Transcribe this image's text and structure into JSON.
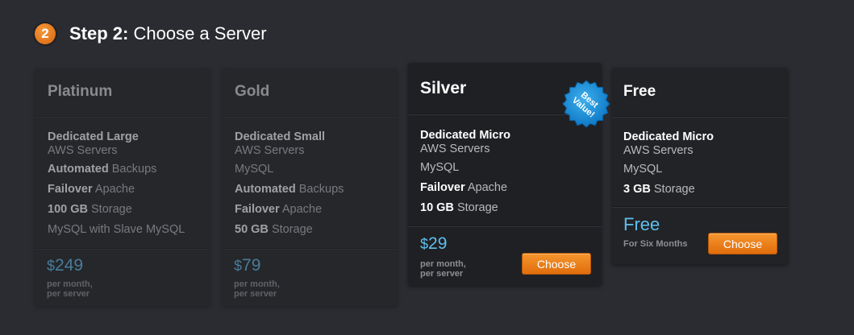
{
  "step": {
    "number": "2",
    "label": "Step 2:",
    "title": "Choose a Server"
  },
  "accent_color": "#f08a24",
  "price_color": "#5ebfef",
  "plans": [
    {
      "name": "Platinum",
      "features": [
        {
          "bold": "Dedicated Large",
          "rest": "AWS Servers"
        },
        {
          "bold": "Automated",
          "rest": " Backups"
        },
        {
          "bold": "Failover",
          "rest": " Apache"
        },
        {
          "bold": "100 GB",
          "rest": " Storage"
        },
        {
          "bold": "",
          "rest": "MySQL with Slave MySQL"
        }
      ],
      "currency": "$",
      "price": "249",
      "per_line1": "per month,",
      "per_line2": "per server"
    },
    {
      "name": "Gold",
      "features": [
        {
          "bold": "Dedicated Small",
          "rest": "AWS Servers"
        },
        {
          "bold": "",
          "rest": "MySQL"
        },
        {
          "bold": "Automated",
          "rest": " Backups"
        },
        {
          "bold": "Failover",
          "rest": " Apache"
        },
        {
          "bold": "50 GB",
          "rest": " Storage"
        }
      ],
      "currency": "$",
      "price": "79",
      "per_line1": "per month,",
      "per_line2": "per server"
    },
    {
      "name": "Silver",
      "badge_line1": "Best",
      "badge_line2": "Value!",
      "features": [
        {
          "bold": "Dedicated Micro",
          "rest": "AWS Servers"
        },
        {
          "bold": "",
          "rest": "MySQL"
        },
        {
          "bold": "Failover",
          "rest": " Apache"
        },
        {
          "bold": "10 GB",
          "rest": " Storage"
        }
      ],
      "currency": "$",
      "price": "29",
      "per_line1": "per month,",
      "per_line2": "per server",
      "button_label": "Choose"
    },
    {
      "name": "Free",
      "features": [
        {
          "bold": "Dedicated Micro",
          "rest": "AWS Servers"
        },
        {
          "bold": "",
          "rest": "MySQL"
        },
        {
          "bold": "3 GB",
          "rest": " Storage"
        }
      ],
      "price": "Free",
      "per_line1": "For Six Months",
      "button_label": "Choose"
    }
  ]
}
